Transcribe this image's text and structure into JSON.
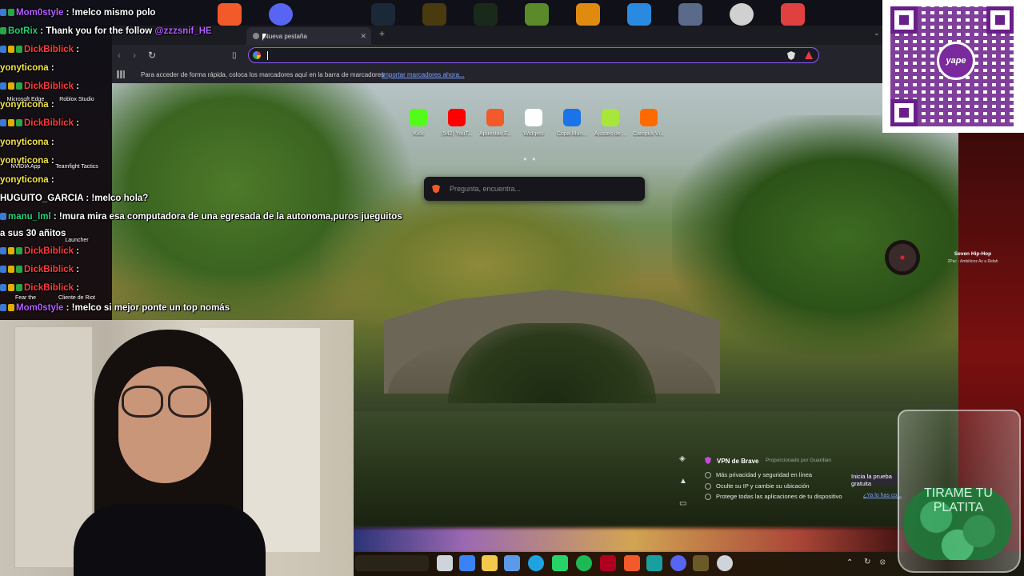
{
  "browser": {
    "tab": {
      "title": "Nueva pestaña"
    },
    "address": {
      "value": ""
    },
    "bookmarks": {
      "hint": "Para acceder de forma rápida, coloca los marcadores aquí en la barra de marcadores",
      "import_link": "Importar marcadores ahora..."
    },
    "tiles": [
      {
        "label": "Kick",
        "color": "#53fc18"
      },
      {
        "label": "(542) YouT...",
        "color": "#ff0000"
      },
      {
        "label": "Apuestas E...",
        "color": "#f25a2a"
      },
      {
        "label": "Widgets",
        "color": "#ffffff"
      },
      {
        "label": "Copa Mun...",
        "color": "#1a73e8"
      },
      {
        "label": "Ajustes de ...",
        "color": "#a8e63b"
      },
      {
        "label": "Campus Vi...",
        "color": "#ff6a00"
      }
    ],
    "search_placeholder": "Pregunta, encuentra...",
    "vpn": {
      "title": "VPN de Brave",
      "provider": "Proporcionado por Guardian",
      "features": [
        "Más privacidad y seguridad en línea",
        "Oculte su IP y cambie su ubicación",
        "Protege todas las aplicaciones de tu dispositivo"
      ],
      "cta": "Inicia la prueba gratuita",
      "link": "¿Ya lo has co..."
    }
  },
  "chat": {
    "messages": [
      {
        "user": "Mom0style",
        "text": ": !melco mismo polo",
        "color": "u-purple"
      },
      {
        "user": "BotRix",
        "text": ": Thank you for the follow",
        "mention": "@zzzsnif_HE",
        "color": "u-green"
      },
      {
        "user": "DickBiblick",
        "text": ":",
        "color": "u-red"
      },
      {
        "user": "yonyticona",
        "text": ":",
        "color": "u-yellow"
      },
      {
        "user": "DickBiblick",
        "text": ":",
        "color": "u-red"
      },
      {
        "user": "yonyticona",
        "text": ":",
        "color": "u-yellow"
      },
      {
        "user": "DickBiblick",
        "text": ":",
        "color": "u-red"
      },
      {
        "user": "yonyticona",
        "text": ":",
        "color": "u-yellow"
      },
      {
        "user": "yonyticona",
        "text": ":",
        "color": "u-yellow"
      },
      {
        "user": "yonyticona",
        "text": ":",
        "color": "u-yellow"
      },
      {
        "user": "HUGUITO_GARCIA",
        "text": ": !melco hola?",
        "color": "u-white"
      },
      {
        "user": "manu_lml",
        "text": ": !mura mira esa computadora de una egresada de la autonoma,puros jueguitos",
        "color": "u-green"
      },
      {
        "user": "",
        "text": "a sus 30 añitos",
        "color": "u-white"
      },
      {
        "user": "DickBiblick",
        "text": ":",
        "color": "u-red"
      },
      {
        "user": "DickBiblick",
        "text": ":",
        "color": "u-red"
      },
      {
        "user": "DickBiblick",
        "text": ":",
        "color": "u-red"
      },
      {
        "user": "Mom0style",
        "text": ": !melco si mejor ponte un top nomás",
        "color": "u-purple"
      }
    ]
  },
  "desktop": {
    "labels": [
      "Microsoft Edge",
      "Roblox Studio",
      "NVIDIA App",
      "Teamfight Tactics",
      "Launcher",
      "Fear the",
      "Cliente de Riot"
    ]
  },
  "music": {
    "title": "Seven Hip-Hop",
    "artist": "2Pac - Ambitionz Az a Ridah"
  },
  "donation": {
    "logo": "yape",
    "jar_text": "TIRAME TU PLATITA"
  }
}
